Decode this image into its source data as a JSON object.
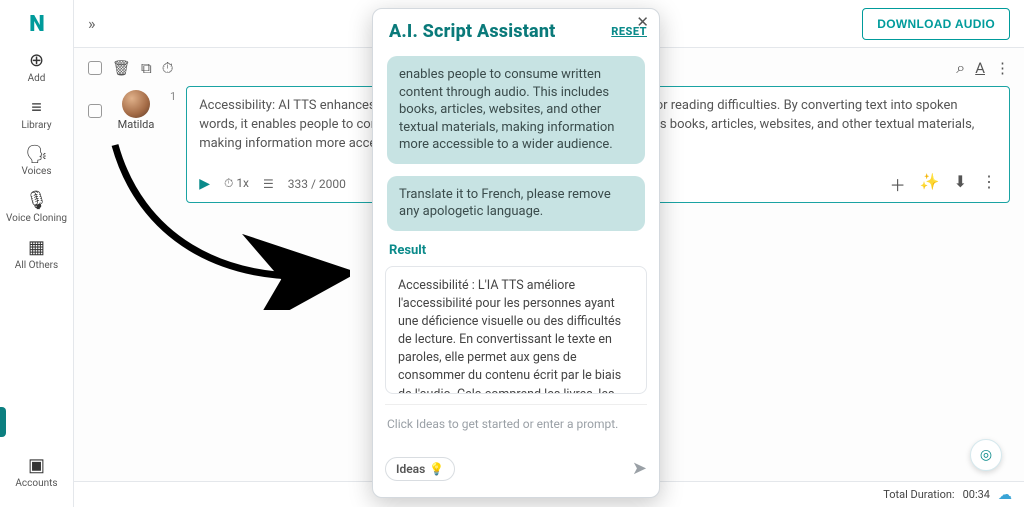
{
  "brand": "N",
  "topbar": {
    "expand_glyph": "»",
    "download_label": "DOWNLOAD AUDIO"
  },
  "sidebar": {
    "items": [
      {
        "icon": "⊕",
        "label": "Add"
      },
      {
        "icon": "≡",
        "label": "Library"
      },
      {
        "icon": "🗣",
        "label": "Voices"
      },
      {
        "icon": "🎙",
        "label": "Voice Cloning"
      },
      {
        "icon": "▦",
        "label": "All Others"
      }
    ],
    "account": {
      "icon": "▣",
      "label": "Accounts"
    }
  },
  "toolbar": {
    "search_icon": "⌕",
    "font_icon": "A"
  },
  "row": {
    "voice_name": "Matilda",
    "index": "1",
    "script_text": "Accessibility: AI TTS enhances accessibility for people with visual impairments or reading difficulties. By converting text into spoken words, it enables people to consume written content through audio. This includes books, articles, websites, and other textual materials, making information more accessible to a wider audience.",
    "controls": {
      "play": "▶",
      "speed": "1x",
      "char_count": "333 / 2000"
    }
  },
  "status": {
    "label": "Total Duration:",
    "value": "00:34"
  },
  "modal": {
    "title": "A.I. Script Assistant",
    "reset": "RESET",
    "bubble1": "enables people to consume written content through audio. This includes books, articles, websites, and other textual materials, making information more accessible to a wider audience.",
    "bubble2": "Translate it to French, please remove any apologetic language.",
    "result_label": "Result",
    "result_text": "Accessibilité : L'IA TTS améliore l'accessibilité pour les personnes ayant une déficience visuelle ou des difficultés de lecture. En convertissant le texte en paroles, elle permet aux gens de consommer du contenu écrit par le biais de l'audio. Cela comprend les livres, les",
    "prompt_placeholder": "Click Ideas to get started or enter a prompt.",
    "ideas_label": "Ideas",
    "ideas_emoji": "💡",
    "send_glyph": "➤"
  }
}
